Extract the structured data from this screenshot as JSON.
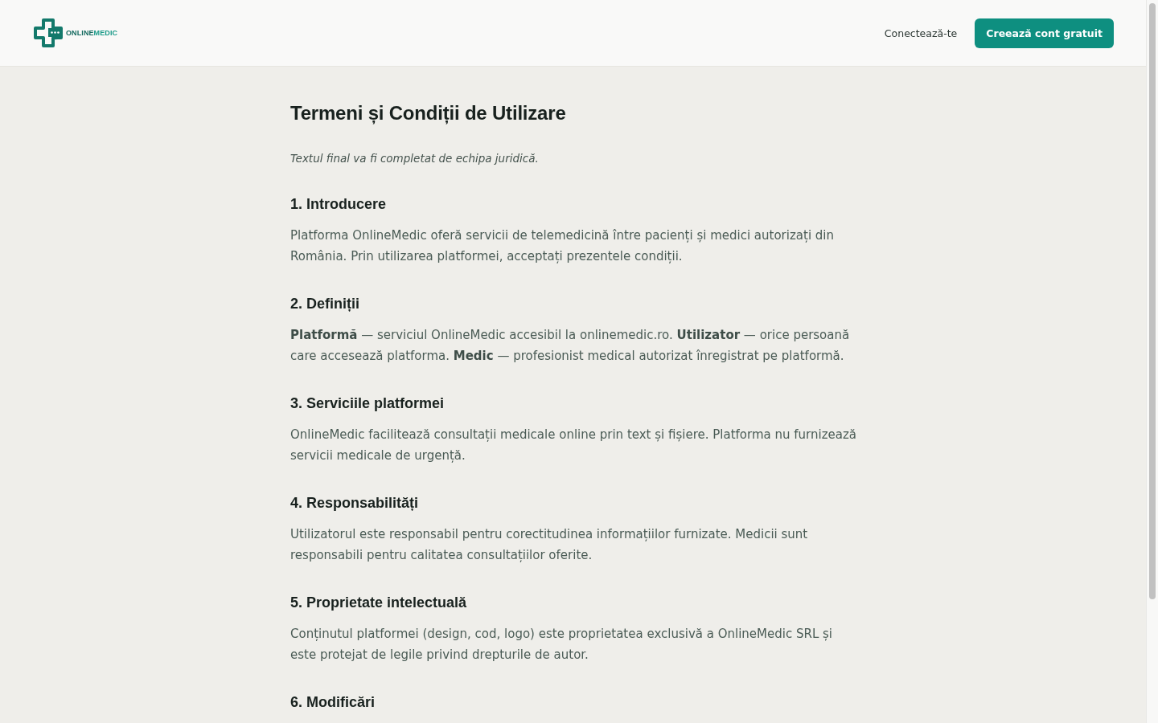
{
  "header": {
    "logo": {
      "wordmark": [
        "ONLINE",
        "MEDIC"
      ]
    },
    "nav": {
      "login_link": "Conectează-te",
      "signup_button": "Creează cont gratuit"
    }
  },
  "page": {
    "title": "Termeni și Condiții de Utilizare",
    "note": "Textul final va fi completat de echipa juridică.",
    "sections": [
      {
        "heading": "1. Introducere",
        "text": "Platforma OnlineMedic oferă servicii de telemedicină între pacienți și medici autorizați din România. Prin utilizarea platformei, acceptați prezentele condiții."
      },
      {
        "heading": "2. Definiții",
        "text": "**Platformă** — serviciul OnlineMedic accesibil la onlinemedic.ro. **Utilizator** — orice persoană care accesează platforma. **Medic** — profesionist medical autorizat înregistrat pe platformă."
      },
      {
        "heading": "3. Serviciile platformei",
        "text": "OnlineMedic facilitează consultații medicale online prin text și fișiere. Platforma nu furnizează servicii medicale de urgență."
      },
      {
        "heading": "4. Responsabilități",
        "text": "Utilizatorul este responsabil pentru corectitudinea informațiilor furnizate. Medicii sunt responsabili pentru calitatea consultațiilor oferite."
      },
      {
        "heading": "5. Proprietate intelectuală",
        "text": "Conținutul platformei (design, cod, logo) este proprietatea exclusivă a OnlineMedic SRL și este protejat de legile privind drepturile de autor."
      },
      {
        "heading": "6. Modificări"
      }
    ]
  }
}
